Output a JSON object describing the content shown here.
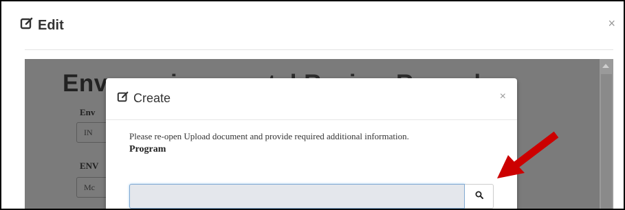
{
  "edit_modal": {
    "title": "Edit",
    "close": "×"
  },
  "background_form": {
    "heading_visible": "Env",
    "heading_faded": "ironmental Review Record",
    "field1_label": "Env",
    "field1_value": "IN",
    "field2_label": "ENV",
    "field2_value": "Mc"
  },
  "create_dialog": {
    "title": "Create",
    "close": "×",
    "message": "Please re-open Upload document and provide required additional information.",
    "program_label": "Program",
    "program_value": "",
    "search_icon": "search-icon"
  },
  "annotation": {
    "arrow_color": "#cc0000"
  }
}
